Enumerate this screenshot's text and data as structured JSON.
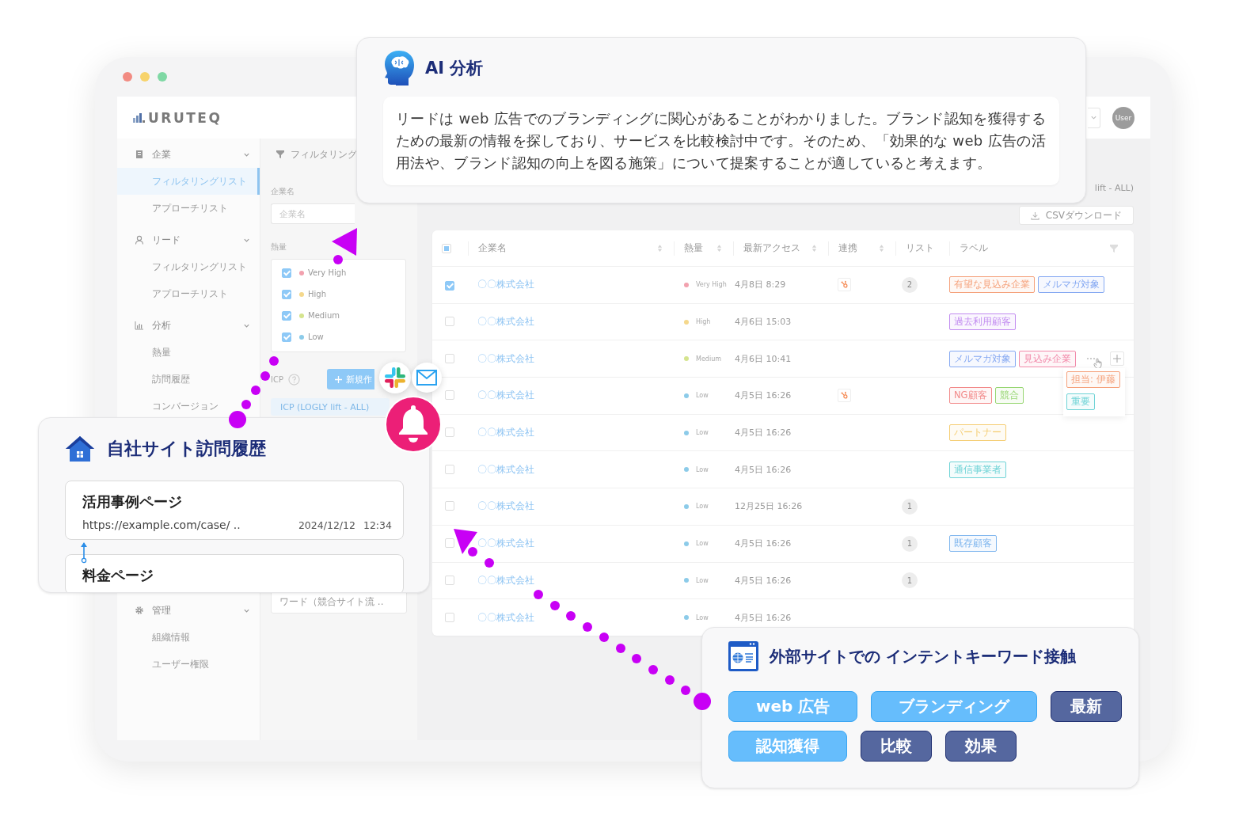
{
  "window": {
    "app_name": "URUTEQ",
    "user": "User"
  },
  "sidebar": {
    "groups": [
      {
        "label": "企業",
        "expanded": true,
        "items": [
          {
            "label": "フィルタリングリスト",
            "selected": true
          },
          {
            "label": "アプローチリスト",
            "selected": false
          }
        ]
      },
      {
        "label": "リード",
        "expanded": true,
        "items": [
          {
            "label": "フィルタリングリスト",
            "selected": false
          },
          {
            "label": "アプローチリスト",
            "selected": false
          }
        ]
      },
      {
        "label": "分析",
        "expanded": true,
        "items": [
          {
            "label": "熱量",
            "selected": false
          },
          {
            "label": "訪問履歴",
            "selected": false
          },
          {
            "label": "コンバージョン",
            "selected": false
          }
        ]
      },
      {
        "label": "管理",
        "expanded": true,
        "items": [
          {
            "label": "組織情報",
            "selected": false
          },
          {
            "label": "ユーザー権限",
            "selected": false
          }
        ]
      }
    ]
  },
  "filter_panel": {
    "title": "フィルタリング",
    "company_label": "企業名",
    "company_placeholder": "企業名",
    "heat_label": "熱量",
    "heat_options": [
      {
        "label": "Very High",
        "color": "#f2a1ae",
        "checked": true
      },
      {
        "label": "High",
        "color": "#f5d88c",
        "checked": true
      },
      {
        "label": "Medium",
        "color": "#d5e48e",
        "checked": true
      },
      {
        "label": "Low",
        "color": "#8ccbe9",
        "checked": true
      }
    ],
    "icp_label": "ICP",
    "new_button": "新規作",
    "icp_list": {
      "label": "ICP (LOGLY lift - ALL)",
      "selected": true
    },
    "keyword_list": "ワード（競合サイト流 .."
  },
  "main": {
    "current_list": "lift - ALL)",
    "csv_button": "CSVダウンロード",
    "table": {
      "indeterminate": true,
      "columns": [
        {
          "label": "企業名",
          "sortable": true
        },
        {
          "label": "熱量",
          "sortable": true
        },
        {
          "label": "最新アクセス",
          "sortable": true
        },
        {
          "label": "連携",
          "sortable": true
        },
        {
          "label": "リスト",
          "sortable": false
        },
        {
          "label": "ラベル",
          "sortable": false
        }
      ],
      "rows": [
        {
          "checked": true,
          "company": "〇〇株式会社",
          "heat": {
            "label": "Very High",
            "color": "#f2a1ae"
          },
          "last_access": "4月8日 8:29",
          "linked": true,
          "list_count": "2",
          "labels": [
            {
              "text": "有望な見込み企業",
              "color": "#f5a27c"
            },
            {
              "text": "メルマガ対象",
              "color": "#86a9f2"
            }
          ]
        },
        {
          "checked": false,
          "company": "〇〇株式会社",
          "heat": {
            "label": "High",
            "color": "#f5d88c"
          },
          "last_access": "4月6日 15:03",
          "linked": false,
          "labels": [
            {
              "text": "過去利用顧客",
              "color": "#c28cf0"
            }
          ]
        },
        {
          "checked": false,
          "company": "〇〇株式会社",
          "heat": {
            "label": "Medium",
            "color": "#d5e48e"
          },
          "last_access": "4月6日 10:41",
          "linked": false,
          "labels": [
            {
              "text": "メルマガ対象",
              "color": "#86a9f2"
            },
            {
              "text": "見込み企業",
              "color": "#f28aaa"
            }
          ],
          "hidden_labels": [
            {
              "text": "担当: 伊藤",
              "color": "#f5a27c"
            },
            {
              "text": "重要",
              "color": "#6fd3d6"
            }
          ]
        },
        {
          "checked": false,
          "company": "〇〇株式会社",
          "heat": {
            "label": "Low",
            "color": "#8ccbe9"
          },
          "last_access": "4月5日 16:26",
          "linked": true,
          "labels": [
            {
              "text": "NG顧客",
              "color": "#f28a8a"
            },
            {
              "text": "競合",
              "color": "#97d672"
            }
          ]
        },
        {
          "checked": false,
          "company": "〇〇株式会社",
          "heat": {
            "label": "Low",
            "color": "#8ccbe9"
          },
          "last_access": "4月5日 16:26",
          "linked": false,
          "labels": [
            {
              "text": "パートナー",
              "color": "#f5cd72"
            }
          ]
        },
        {
          "checked": false,
          "company": "〇〇株式会社",
          "heat": {
            "label": "Low",
            "color": "#8ccbe9"
          },
          "last_access": "4月5日 16:26",
          "linked": false,
          "labels": [
            {
              "text": "通信事業者",
              "color": "#6fd3d6"
            }
          ]
        },
        {
          "checked": false,
          "company": "〇〇株式会社",
          "heat": {
            "label": "Low",
            "color": "#8ccbe9"
          },
          "last_access": "12月25日 16:26",
          "linked": false,
          "list_count": "1"
        },
        {
          "checked": false,
          "company": "〇〇株式会社",
          "heat": {
            "label": "Low",
            "color": "#8ccbe9"
          },
          "last_access": "4月5日 16:26",
          "linked": false,
          "list_count": "1",
          "labels": [
            {
              "text": "既存顧客",
              "color": "#7fb6ee"
            }
          ]
        },
        {
          "checked": false,
          "company": "〇〇株式会社",
          "heat": {
            "label": "Low",
            "color": "#8ccbe9"
          },
          "last_access": "4月5日 16:26",
          "linked": false,
          "list_count": "1"
        },
        {
          "checked": false,
          "company": "〇〇株式会社",
          "heat": {
            "label": "Low",
            "color": "#8ccbe9"
          },
          "last_access": "4月5日 16:26",
          "linked": false
        }
      ]
    }
  },
  "ai_analysis": {
    "title": "AI 分析",
    "text": "リードは web 広告でのブランディングに関心があることがわかりました。ブランド認知を獲得するための最新の情報を探しており、サービスを比較検討中です。そのため、「効果的な web 広告の活用法や、ブランド認知の向上を図る施策」について提案することが適していると考えます。"
  },
  "visit_history": {
    "title": "自社サイト訪問履歴",
    "pages": [
      {
        "title": "活用事例ページ",
        "url": "https://example.com/case/ ..",
        "date": "2024/12/12",
        "time": "12:34"
      },
      {
        "title": "料金ページ"
      }
    ]
  },
  "intent_keywords": {
    "title": "外部サイトでの インテントキーワード接触",
    "keywords": [
      {
        "text": "web 広告",
        "kind": "primary"
      },
      {
        "text": "ブランディング",
        "kind": "primary"
      },
      {
        "text": "最新",
        "kind": "secondary"
      },
      {
        "text": "認知獲得",
        "kind": "primary"
      },
      {
        "text": "比較",
        "kind": "secondary"
      },
      {
        "text": "効果",
        "kind": "secondary"
      }
    ]
  }
}
